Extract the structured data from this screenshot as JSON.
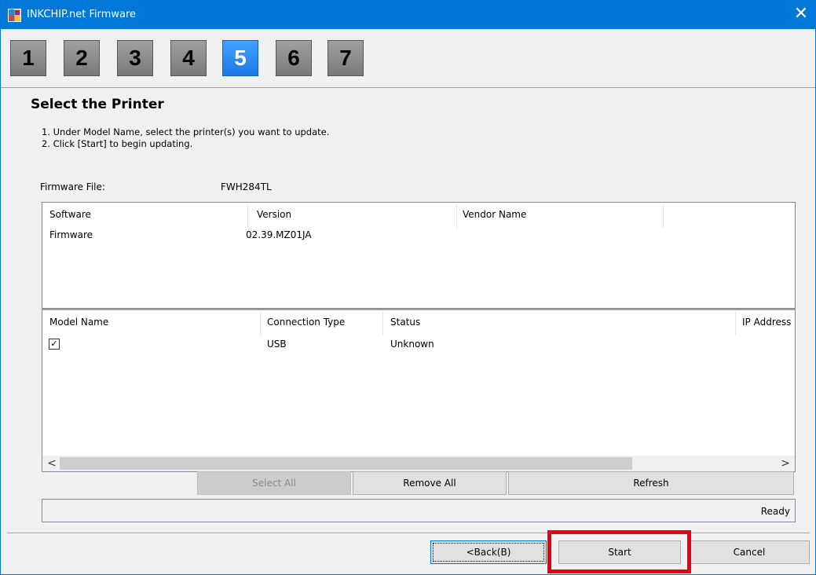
{
  "window": {
    "title": "INKCHIP.net Firmware",
    "close_glyph": "✕"
  },
  "steps": [
    {
      "label": "1",
      "active": false
    },
    {
      "label": "2",
      "active": false
    },
    {
      "label": "3",
      "active": false
    },
    {
      "label": "4",
      "active": false
    },
    {
      "label": "5",
      "active": true
    },
    {
      "label": "6",
      "active": false
    },
    {
      "label": "7",
      "active": false
    }
  ],
  "page": {
    "heading": "Select the Printer",
    "instructions": [
      "1. Under Model Name, select the printer(s) you want to update.",
      "2. Click [Start] to begin updating."
    ],
    "firmware_file_label": "Firmware File:",
    "firmware_file_value": "FWH284TL"
  },
  "software_list": {
    "columns": [
      "Software",
      "Version",
      "Vendor Name",
      ""
    ],
    "rows": [
      {
        "software": "Firmware",
        "version": "02.39.MZ01JA",
        "vendor": ""
      }
    ]
  },
  "model_list": {
    "columns": [
      "Model Name",
      "Connection Type",
      "Status",
      "IP Address"
    ],
    "rows": [
      {
        "checked": true,
        "check_glyph": "✓",
        "model": "",
        "connection": "USB",
        "status": "Unknown",
        "ip": ""
      }
    ],
    "scroll_left_glyph": "<",
    "scroll_right_glyph": ">"
  },
  "list_buttons": {
    "select_all": "Select All",
    "remove_all": "Remove All",
    "refresh": "Refresh"
  },
  "status": {
    "text": "Ready"
  },
  "footer_buttons": {
    "back": "<Back(B)",
    "start": "Start",
    "cancel": "Cancel"
  },
  "colors": {
    "titlebar": "#0078d7",
    "active_step": "#1e78e6",
    "highlight": "#e60012"
  }
}
